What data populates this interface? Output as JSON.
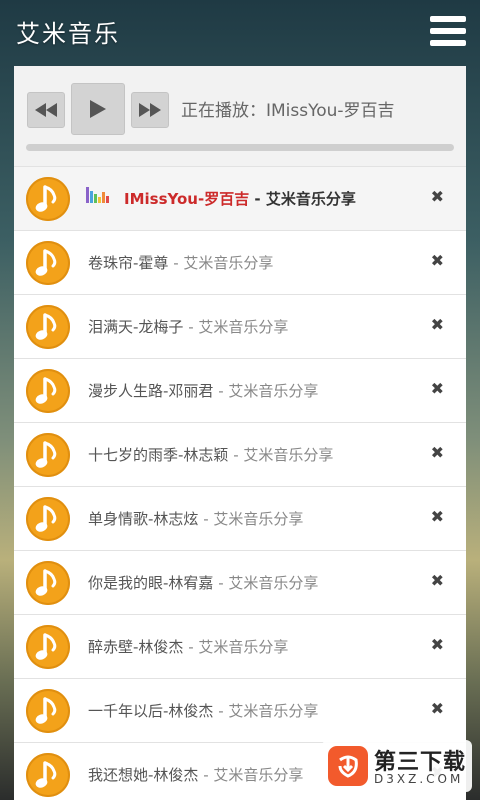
{
  "header": {
    "title": "艾米音乐",
    "menu_icon": "hamburger-menu-icon"
  },
  "player": {
    "prev_icon": "rewind-icon",
    "play_icon": "play-icon",
    "next_icon": "fast-forward-icon",
    "now_playing": "正在播放：IMissYou-罗百吉",
    "progress_percent": 0
  },
  "playlist": [
    {
      "title": "IMissYou-罗百吉",
      "sep": " - ",
      "tag": "艾米音乐分享",
      "active": true
    },
    {
      "title": "卷珠帘-霍尊",
      "sep": " - ",
      "tag": "艾米音乐分享"
    },
    {
      "title": "泪满天-龙梅子",
      "sep": " - ",
      "tag": "艾米音乐分享"
    },
    {
      "title": "漫步人生路-邓丽君",
      "sep": " - ",
      "tag": "艾米音乐分享"
    },
    {
      "title": "十七岁的雨季-林志颖",
      "sep": " - ",
      "tag": "艾米音乐分享"
    },
    {
      "title": "单身情歌-林志炫",
      "sep": " - ",
      "tag": "艾米音乐分享"
    },
    {
      "title": "你是我的眼-林宥嘉",
      "sep": " - ",
      "tag": "艾米音乐分享"
    },
    {
      "title": "醉赤壁-林俊杰",
      "sep": " - ",
      "tag": "艾米音乐分享"
    },
    {
      "title": "一千年以后-林俊杰",
      "sep": " - ",
      "tag": "艾米音乐分享"
    },
    {
      "title": "我还想她-林俊杰",
      "sep": " - ",
      "tag": "艾米音乐分享"
    }
  ],
  "remove_glyph": "✖",
  "watermark": {
    "name": "第三下载",
    "domain": "D3XZ.COM"
  },
  "colors": {
    "accent_orange": "#f3a21a",
    "active_title": "#cc2a2a"
  }
}
